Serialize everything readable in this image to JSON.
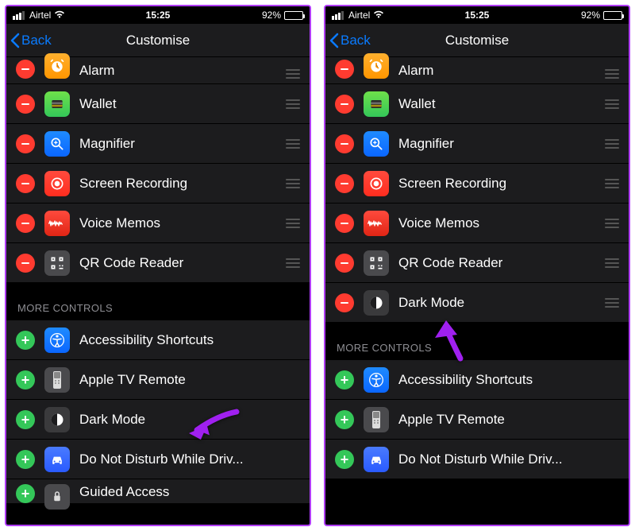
{
  "status": {
    "carrier": "Airtel",
    "time": "15:25",
    "battery": "92%"
  },
  "nav": {
    "back": "Back",
    "title": "Customise"
  },
  "section_more": "MORE CONTROLS",
  "left": {
    "included": [
      {
        "label": "Alarm",
        "icon": "alarm"
      },
      {
        "label": "Wallet",
        "icon": "wallet"
      },
      {
        "label": "Magnifier",
        "icon": "mag"
      },
      {
        "label": "Screen Recording",
        "icon": "screen"
      },
      {
        "label": "Voice Memos",
        "icon": "voice"
      },
      {
        "label": "QR Code Reader",
        "icon": "qr"
      }
    ],
    "more": [
      {
        "label": "Accessibility Shortcuts",
        "icon": "acc"
      },
      {
        "label": "Apple TV Remote",
        "icon": "tv"
      },
      {
        "label": "Dark Mode",
        "icon": "dark"
      },
      {
        "label": "Do Not Disturb While Driv...",
        "icon": "dnd"
      },
      {
        "label": "Guided Access",
        "icon": "guided"
      }
    ]
  },
  "right": {
    "included": [
      {
        "label": "Alarm",
        "icon": "alarm"
      },
      {
        "label": "Wallet",
        "icon": "wallet"
      },
      {
        "label": "Magnifier",
        "icon": "mag"
      },
      {
        "label": "Screen Recording",
        "icon": "screen"
      },
      {
        "label": "Voice Memos",
        "icon": "voice"
      },
      {
        "label": "QR Code Reader",
        "icon": "qr"
      },
      {
        "label": "Dark Mode",
        "icon": "dark"
      }
    ],
    "more": [
      {
        "label": "Accessibility Shortcuts",
        "icon": "acc"
      },
      {
        "label": "Apple TV Remote",
        "icon": "tv"
      },
      {
        "label": "Do Not Disturb While Driv...",
        "icon": "dnd"
      }
    ]
  }
}
